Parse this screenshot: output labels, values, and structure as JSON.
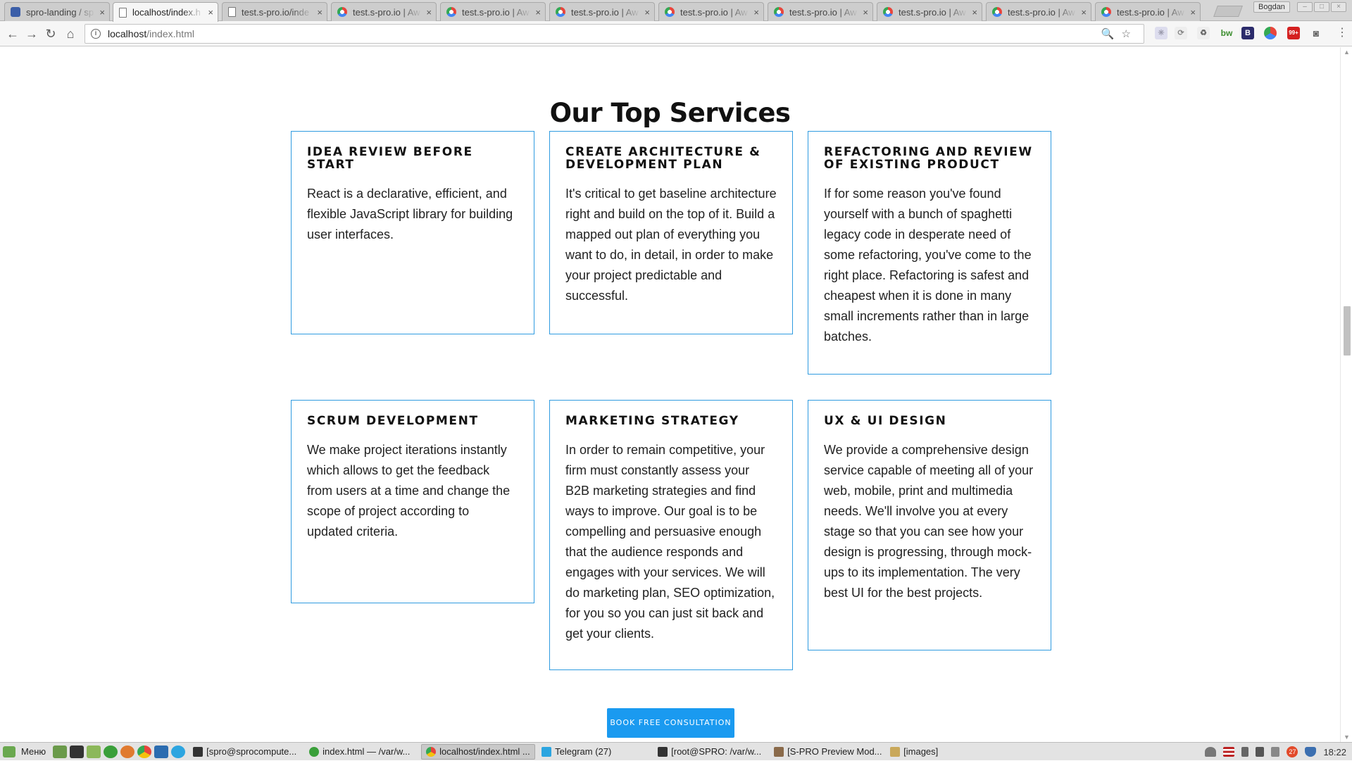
{
  "browser": {
    "tabs": [
      {
        "title": "spro-landing / sp",
        "icon": "gitlab-icon"
      },
      {
        "title": "localhost/index.h",
        "icon": "page-icon",
        "active": true
      },
      {
        "title": "test.s-pro.io/inde",
        "icon": "page-icon"
      },
      {
        "title": "test.s-pro.io | Aw",
        "icon": "chrome-ring-icon"
      },
      {
        "title": "test.s-pro.io | Aw",
        "icon": "chrome-ring-icon"
      },
      {
        "title": "test.s-pro.io | Aw",
        "icon": "chrome-ring-icon"
      },
      {
        "title": "test.s-pro.io | Aw",
        "icon": "chrome-ring-icon"
      },
      {
        "title": "test.s-pro.io | Aw",
        "icon": "chrome-ring-icon"
      },
      {
        "title": "test.s-pro.io | Aw",
        "icon": "chrome-ring-icon"
      },
      {
        "title": "test.s-pro.io | Aw",
        "icon": "chrome-ring-icon"
      },
      {
        "title": "test.s-pro.io | Aw",
        "icon": "chrome-ring-icon"
      }
    ],
    "tab_close": "×",
    "profile_name": "Bogdan",
    "address": {
      "host": "localhost",
      "path": "/index.html"
    }
  },
  "page": {
    "section_title": "Our Top Services",
    "services": [
      {
        "title": "IDEA REVIEW BEFORE START",
        "text": "React is a declarative, efficient, and flexible JavaScript library for building user interfaces."
      },
      {
        "title": "CREATE ARCHITECTURE & DEVELOPMENT PLAN",
        "text": "It's critical to get baseline architecture right and build on the top of it. Build a mapped out plan of everything you want to do, in detail, in order to make your project predictable and successful."
      },
      {
        "title": "REFACTORING AND REVIEW OF EXISTING PRODUCT",
        "text": "If for some reason you've found yourself with a bunch of spaghetti legacy code in desperate need of some refactoring, you've come to the right place. Refactoring is safest and cheapest when it is done in many small increments rather than in large batches."
      },
      {
        "title": "SCRUM DEVELOPMENT",
        "text": "We make project iterations instantly which allows to get the feedback from users at a time and change the scope of project according to updated criteria."
      },
      {
        "title": "MARKETING STRATEGY",
        "text": "In order to remain competitive, your firm must constantly assess your B2B marketing strategies and find ways to improve. Our goal is to be compelling and persuasive enough that the audience responds and engages with your services. We will do marketing plan, SEO optimization, for you so you can just sit back and get your clients."
      },
      {
        "title": "UX & UI DESIGN",
        "text": "We provide a comprehensive design service capable of meeting all of your web, mobile, print and multimedia needs. We'll involve you at every stage so that you can see how your design is progressing, through mock-ups to its implementation. The very best UI for the best projects."
      }
    ],
    "cta_label": "BOOK FREE CONSULTATION",
    "accent_color": "#2f9be0",
    "button_color": "#1a9af0"
  },
  "taskbar": {
    "menu_label": "Меню",
    "tasks": [
      {
        "label": "[spro@sprocompute...",
        "icon": "terminal-icon"
      },
      {
        "label": "index.html — /var/w...",
        "icon": "editor-icon"
      },
      {
        "label": "localhost/index.html ...",
        "icon": "chrome-icon",
        "active": true
      },
      {
        "label": "Telegram (27)",
        "icon": "telegram-icon"
      },
      {
        "label": "[root@SPRO: /var/w...",
        "icon": "terminal-icon"
      },
      {
        "label": "[S-PRO Preview Mod...",
        "icon": "gimp-icon"
      },
      {
        "label": "[images]",
        "icon": "folder-icon"
      }
    ],
    "clock": "18:22",
    "notification_count": "27"
  }
}
